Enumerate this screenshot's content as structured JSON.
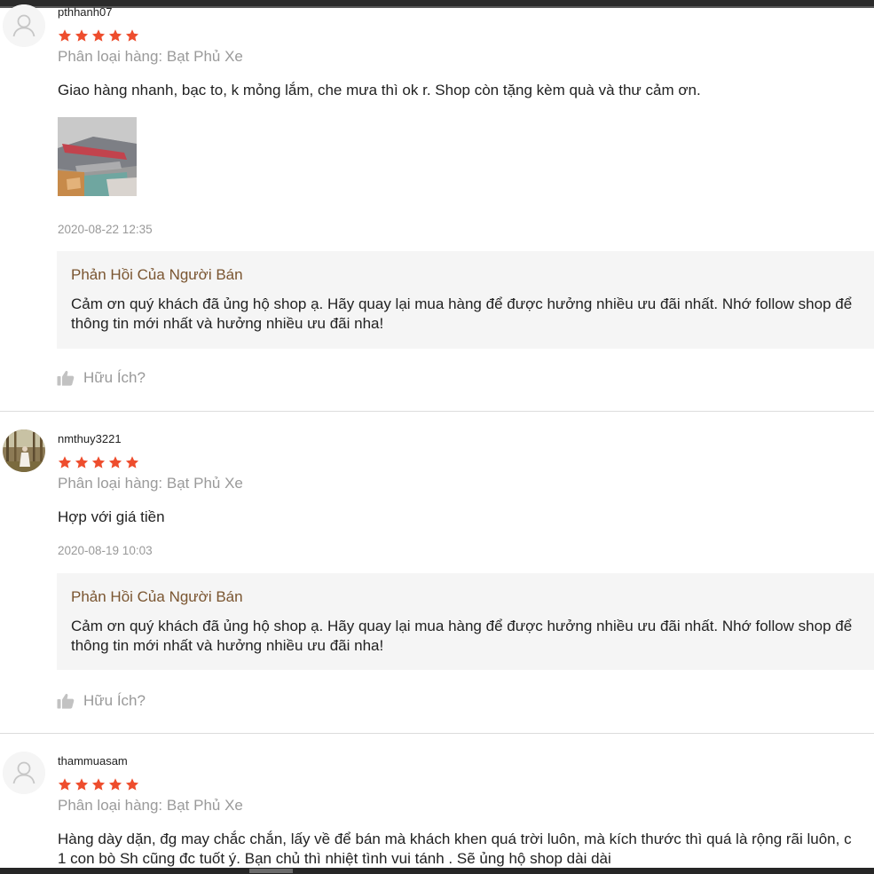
{
  "colors": {
    "star": "#ee4d2d",
    "reply_title": "#7a5530",
    "muted": "#9a9a9a",
    "reply_bg": "#f5f5f5"
  },
  "helpful_icon": "thumbs-up-icon",
  "reviews": [
    {
      "username": "pthhanh07",
      "rating": 5,
      "variation": "Phân loại hàng: Bạt Phủ Xe",
      "comment": "Giao hàng nhanh, bạc to, k mỏng lắm, che mưa thì ok r. Shop còn tặng kèm quà và thư cảm ơn.",
      "timestamp": "2020-08-22 12:35",
      "reply_title": "Phản Hồi Của Người Bán",
      "reply_text": "Cảm ơn quý khách đã ủng hộ shop ạ. Hãy quay lại mua hàng để được hưởng nhiều ưu đãi nhất. Nhớ follow shop để\nthông tin mới nhất và hưởng nhiều ưu đãi nha!",
      "helpful_label": "Hữu Ích?"
    },
    {
      "username": "nmthuy3221",
      "rating": 5,
      "variation": "Phân loại hàng: Bạt Phủ Xe",
      "comment": "Hợp với giá tiền",
      "timestamp": "2020-08-19 10:03",
      "reply_title": "Phản Hồi Của Người Bán",
      "reply_text": "Cảm ơn quý khách đã ủng hộ shop ạ. Hãy quay lại mua hàng để được hưởng nhiều ưu đãi nhất. Nhớ follow shop để\nthông tin mới nhất và hưởng nhiều ưu đãi nha!",
      "helpful_label": "Hữu Ích?"
    },
    {
      "username": "thammuasam",
      "rating": 5,
      "variation": "Phân loại hàng: Bạt Phủ Xe",
      "comment": "Hàng dày dặn, đg may chắc chắn, lấy về để bán mà khách khen quá trời luôn, mà kích thước thì quá là rộng rãi luôn, c\n1 con bò Sh cũng đc tuốt ý. Bạn chủ thì nhiệt tình vui tánh . Sẽ ủng hộ shop dài dài"
    }
  ]
}
